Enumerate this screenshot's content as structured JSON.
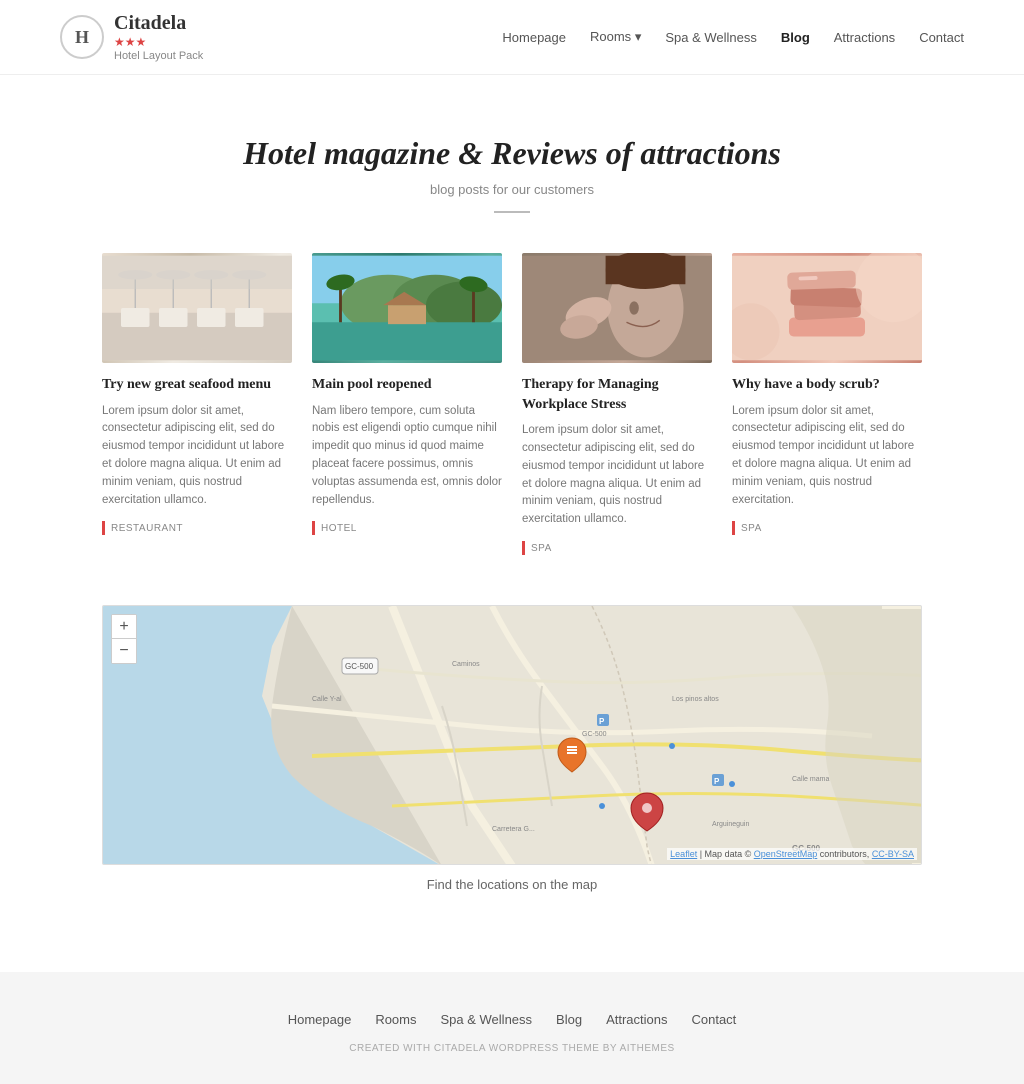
{
  "header": {
    "logo_letter": "H",
    "logo_title": "Citadela",
    "logo_subtitle": "Hotel Layout Pack",
    "logo_stars": "★★★",
    "nav": {
      "homepage": "Homepage",
      "rooms": "Rooms",
      "spa": "Spa & Wellness",
      "blog": "Blog",
      "attractions": "Attractions",
      "contact": "Contact"
    }
  },
  "blog": {
    "title": "Hotel magazine & Reviews of attractions",
    "subtitle": "blog posts for our customers",
    "cards": [
      {
        "id": "card1",
        "title": "Try new great seafood menu",
        "body": "Lorem ipsum dolor sit amet, consectetur adipiscing elit, sed do eiusmod tempor incididunt ut labore et dolore magna aliqua. Ut enim ad minim veniam, quis nostrud exercitation ullamco.",
        "tag": "RESTAURANT",
        "img_class": "img-restaurant"
      },
      {
        "id": "card2",
        "title": "Main pool reopened",
        "body": "Nam libero tempore, cum soluta nobis est eligendi optio cumque nihil impedit quo minus id quod maime placeat facere possimus, omnis voluptas assumenda est, omnis dolor repellendus.",
        "tag": "HOTEL",
        "img_class": "img-pool"
      },
      {
        "id": "card3",
        "title": "Therapy for Managing Workplace Stress",
        "body": "Lorem ipsum dolor sit amet, consectetur adipiscing elit, sed do eiusmod tempor incididunt ut labore et dolore magna aliqua. Ut enim ad minim veniam, quis nostrud exercitation ullamco.",
        "tag": "SPA",
        "img_class": "img-therapy"
      },
      {
        "id": "card4",
        "title": "Why have a body scrub?",
        "body": "Lorem ipsum dolor sit amet, consectetur adipiscing elit, sed do eiusmod tempor incididunt ut labore et dolore magna aliqua. Ut enim ad minim veniam, quis nostrud exercitation.",
        "tag": "SPA",
        "img_class": "img-scrub"
      }
    ]
  },
  "map": {
    "caption": "Find the locations on the map",
    "attribution": "Leaflet | Map data © OpenStreetMap contributors, CC-BY-SA",
    "zoom_in": "+",
    "zoom_out": "−"
  },
  "footer": {
    "nav": [
      "Homepage",
      "Rooms",
      "Spa & Wellness",
      "Blog",
      "Attractions",
      "Contact"
    ],
    "credit": "CREATED WITH CITADELA WORDPRESS THEME BY AITHEMES"
  }
}
